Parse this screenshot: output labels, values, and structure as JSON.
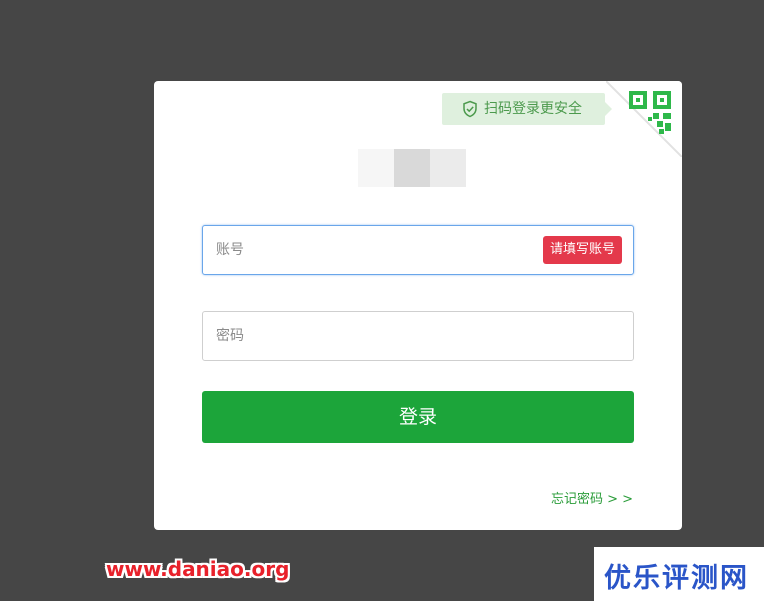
{
  "qr_tip": {
    "label": "扫码登录更安全",
    "icon": "shield-check-icon"
  },
  "qr_corner": {
    "icon": "qr-code-icon"
  },
  "form": {
    "account": {
      "placeholder": "账号",
      "value": "",
      "error": "请填写账号"
    },
    "password": {
      "placeholder": "密码",
      "value": ""
    },
    "login_label": "登录",
    "forgot_label": "忘记密码 > >"
  },
  "watermarks": {
    "url": "www.daniao.org",
    "site": "优乐评测网"
  },
  "colors": {
    "background": "#464646",
    "primary_green": "#1ca53a",
    "link_green": "#2a9c39",
    "error_red": "#e4394b",
    "focus_blue": "#6aa6ea",
    "tip_bg": "#dff0de"
  }
}
